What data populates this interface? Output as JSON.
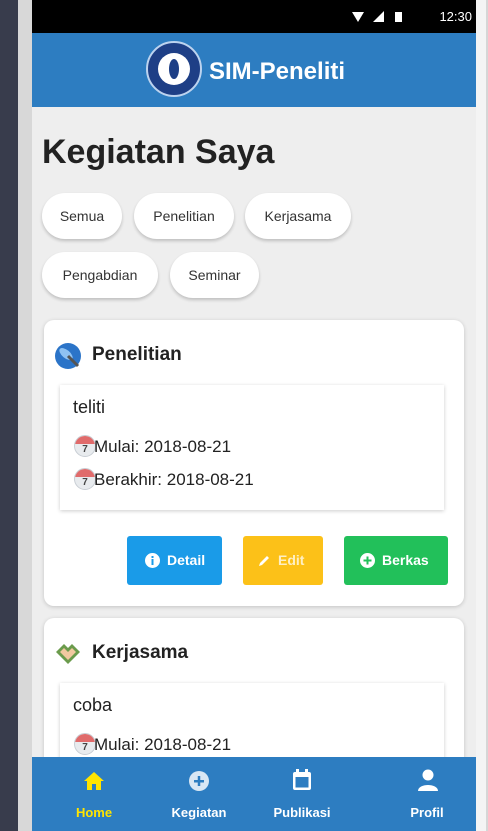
{
  "status_bar": {
    "time": "12:30"
  },
  "app_bar": {
    "title": "SIM-Peneliti",
    "logo_icon": "university-seal-icon"
  },
  "page": {
    "title": "Kegiatan Saya"
  },
  "filters": [
    "Semua",
    "Penelitian",
    "Kerjasama",
    "Pengabdian",
    "Seminar"
  ],
  "cards": [
    {
      "category": "Penelitian",
      "category_icon": "satellite-dish-icon",
      "items": [
        {
          "title": "teliti",
          "start": "Mulai: 2018-08-21",
          "end": "Berakhir: 2018-08-21"
        }
      ],
      "buttons": {
        "detail": "Detail",
        "edit": "Edit",
        "berkas": "Berkas"
      }
    },
    {
      "category": "Kerjasama",
      "category_icon": "handshake-icon",
      "items": [
        {
          "title": "coba",
          "start": "Mulai: 2018-08-21"
        }
      ]
    }
  ],
  "calendar_day": "7",
  "bottom_nav": [
    {
      "label": "Home",
      "icon": "home-icon",
      "active": true
    },
    {
      "label": "Kegiatan",
      "icon": "plus-circle-icon",
      "active": false
    },
    {
      "label": "Publikasi",
      "icon": "calendar-icon",
      "active": false
    },
    {
      "label": "Profil",
      "icon": "person-icon",
      "active": false
    }
  ],
  "colors": {
    "primary": "#2d7dc1",
    "active_nav": "#ffe400",
    "detail_button": "#1a9be8",
    "edit_button": "#fcc118",
    "berkas_button": "#22c05a"
  }
}
